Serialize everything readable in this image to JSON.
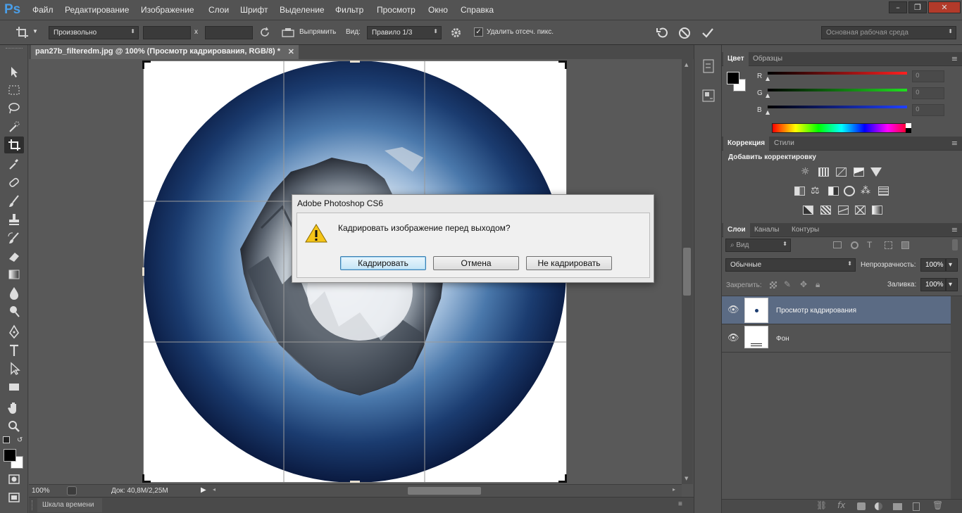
{
  "menu": {
    "logo": "Ps",
    "items": [
      "Файл",
      "Редактирование",
      "Изображение",
      "Слои",
      "Шрифт",
      "Выделение",
      "Фильтр",
      "Просмотр",
      "Окно",
      "Справка"
    ]
  },
  "options": {
    "ratio": "Произвольно",
    "x_sep": "x",
    "straighten": "Выпрямить",
    "view_label": "Вид:",
    "view_value": "Правило 1/3",
    "delete_cropped": "Удалить отсеч. пикс.",
    "workspace": "Основная рабочая среда"
  },
  "document": {
    "tab_title": "pan27b_filteredm.jpg @ 100% (Просмотр кадрирования, RGB/8) *",
    "zoom": "100%",
    "doc_size": "Док: 40,8M/2,25M",
    "timeline": "Шкала времени"
  },
  "color_panel": {
    "tabs": [
      "Цвет",
      "Образцы"
    ],
    "channels": [
      {
        "label": "R",
        "value": "0",
        "color": "#ff2020"
      },
      {
        "label": "G",
        "value": "0",
        "color": "#20e020"
      },
      {
        "label": "B",
        "value": "0",
        "color": "#2040ff"
      }
    ]
  },
  "adjust_panel": {
    "tabs": [
      "Коррекция",
      "Стили"
    ],
    "title": "Добавить корректировку"
  },
  "layers_panel": {
    "tabs": [
      "Слои",
      "Каналы",
      "Контуры"
    ],
    "filter": "Вид",
    "blend_mode": "Обычные",
    "opacity_label": "Непрозрачность:",
    "opacity": "100%",
    "lock_label": "Закрепить:",
    "fill_label": "Заливка:",
    "fill": "100%",
    "layers": [
      {
        "name": "Просмотр кадрирования",
        "selected": true
      },
      {
        "name": "Фон",
        "selected": false
      }
    ]
  },
  "dialog": {
    "title": "Adobe Photoshop CS6",
    "message": "Кадрировать изображение перед выходом?",
    "buttons": [
      "Кадрировать",
      "Отмена",
      "Не кадрировать"
    ]
  },
  "colors": {
    "accent": "#4a9ee8",
    "layer_selected": "#5b6b84",
    "panel_bg": "#535353"
  }
}
